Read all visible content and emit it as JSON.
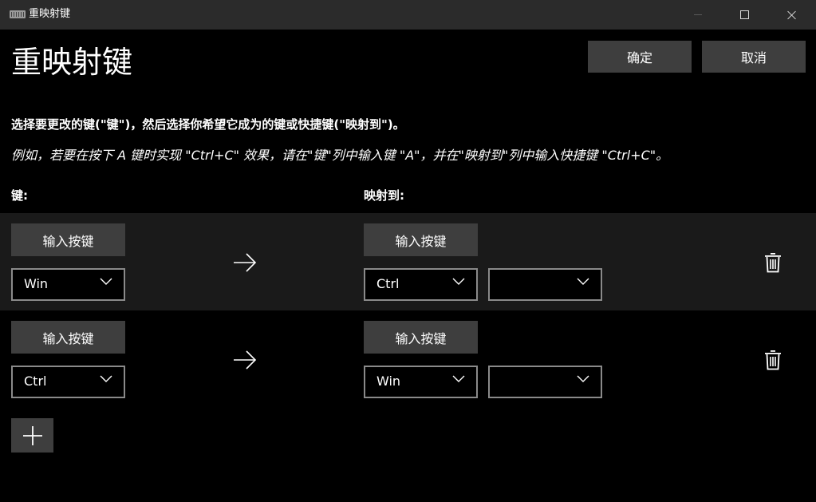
{
  "window": {
    "title": "重映射键"
  },
  "header": {
    "title": "重映射键",
    "ok_label": "确定",
    "cancel_label": "取消"
  },
  "instructions": {
    "line1": "选择要更改的键(\"键\")，然后选择你希望它成为的键或快捷键(\"映射到\")。",
    "line2": "例如，若要在按下 A 键时实现 \"Ctrl+C\" 效果，请在\"键\"列中输入键 \"A\"，并在\"映射到\"列中输入快捷键 \"Ctrl+C\"。"
  },
  "columns": {
    "key_label": "键:",
    "map_label": "映射到:"
  },
  "rows": [
    {
      "key_button": "输入按键",
      "key_value": "Win",
      "map_button": "输入按键",
      "map_value1": "Ctrl",
      "map_value2": ""
    },
    {
      "key_button": "输入按键",
      "key_value": "Ctrl",
      "map_button": "输入按键",
      "map_value1": "Win",
      "map_value2": ""
    }
  ],
  "icons": {
    "arrow": "arrow-right-icon",
    "delete": "trash-icon",
    "add": "plus-icon",
    "dropdown": "chevron-down-icon"
  },
  "colors": {
    "background": "#000000",
    "titlebar": "#2b2b2b",
    "button": "#3e3e3e",
    "row_highlight": "#1a1a1a",
    "dropdown_border": "#8a8a8a",
    "text": "#ffffff"
  }
}
